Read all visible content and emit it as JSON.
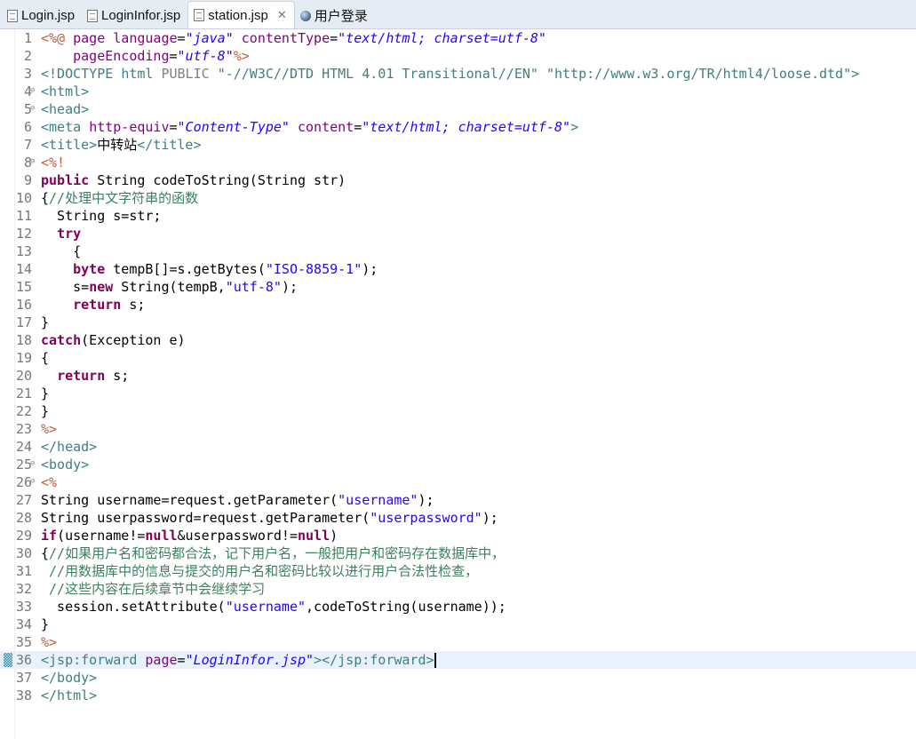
{
  "tabs": [
    {
      "label": "Login.jsp",
      "icon": "jsp-file-icon",
      "active": false
    },
    {
      "label": "LoginInfor.jsp",
      "icon": "jsp-file-icon",
      "active": false
    },
    {
      "label": "station.jsp",
      "icon": "jsp-file-icon",
      "active": true,
      "closable": true
    },
    {
      "label": "用户登录",
      "icon": "globe-icon",
      "active": false
    }
  ],
  "colors": {
    "tag": "#3f7f7f",
    "attribute": "#7f007f",
    "string": "#2a00ff",
    "jsp_delimiter": "#bf5f3f",
    "keyword": "#7f0055",
    "comment": "#3f7f5f",
    "current_line": "#e8f2fe"
  },
  "editor": {
    "current_line": 36,
    "folded_lines": [
      4,
      5,
      8,
      25,
      26
    ],
    "lines": [
      [
        [
          "jsp",
          "<%@ "
        ],
        [
          "attr",
          "page language"
        ],
        [
          "plain",
          "="
        ],
        [
          "str",
          "\"java\""
        ],
        [
          "plain",
          " "
        ],
        [
          "attr",
          "contentType"
        ],
        [
          "plain",
          "="
        ],
        [
          "str",
          "\"text/html; charset=utf-8\""
        ]
      ],
      [
        [
          "plain",
          "    "
        ],
        [
          "attr",
          "pageEncoding"
        ],
        [
          "plain",
          "="
        ],
        [
          "str",
          "\"utf-8\""
        ],
        [
          "jsp",
          "%>"
        ]
      ],
      [
        [
          "tag",
          "<!DOCTYPE "
        ],
        [
          "dtk",
          "html"
        ],
        [
          "dt",
          " PUBLIC "
        ],
        [
          "tag",
          "\"-//W3C//DTD HTML 4.01 Transitional//EN\" \"http://www.w3.org/TR/html4/loose.dtd\">"
        ]
      ],
      [
        [
          "tag",
          "<html>"
        ]
      ],
      [
        [
          "tag",
          "<head>"
        ]
      ],
      [
        [
          "tag",
          "<meta "
        ],
        [
          "attr",
          "http-equiv"
        ],
        [
          "plain",
          "="
        ],
        [
          "str",
          "\"Content-Type\""
        ],
        [
          "plain",
          " "
        ],
        [
          "attr",
          "content"
        ],
        [
          "plain",
          "="
        ],
        [
          "str",
          "\"text/html; charset=utf-8\""
        ],
        [
          "tag",
          ">"
        ]
      ],
      [
        [
          "tag",
          "<title>"
        ],
        [
          "plain",
          "中转站"
        ],
        [
          "tag",
          "</title>"
        ]
      ],
      [
        [
          "jsp",
          "<%!"
        ]
      ],
      [
        [
          "kw",
          "public"
        ],
        [
          "plain",
          " String codeToString(String str)"
        ]
      ],
      [
        [
          "plain",
          "{"
        ],
        [
          "cmt",
          "//处理中文字符串的函数"
        ]
      ],
      [
        [
          "plain",
          "  String s=str;"
        ]
      ],
      [
        [
          "plain",
          "  "
        ],
        [
          "kw",
          "try"
        ]
      ],
      [
        [
          "plain",
          "    {"
        ]
      ],
      [
        [
          "plain",
          "    "
        ],
        [
          "kw",
          "byte"
        ],
        [
          "plain",
          " tempB[]=s.getBytes("
        ],
        [
          "jstr",
          "\"ISO-8859-1\""
        ],
        [
          "plain",
          ");"
        ]
      ],
      [
        [
          "plain",
          "    s="
        ],
        [
          "kw",
          "new"
        ],
        [
          "plain",
          " String(tempB,"
        ],
        [
          "jstr",
          "\"utf-8\""
        ],
        [
          "plain",
          ");"
        ]
      ],
      [
        [
          "plain",
          "    "
        ],
        [
          "kw",
          "return"
        ],
        [
          "plain",
          " s;"
        ]
      ],
      [
        [
          "plain",
          "}"
        ]
      ],
      [
        [
          "kw",
          "catch"
        ],
        [
          "plain",
          "(Exception e)"
        ]
      ],
      [
        [
          "plain",
          "{"
        ]
      ],
      [
        [
          "plain",
          "  "
        ],
        [
          "kw",
          "return"
        ],
        [
          "plain",
          " s;"
        ]
      ],
      [
        [
          "plain",
          "}"
        ]
      ],
      [
        [
          "plain",
          "}"
        ]
      ],
      [
        [
          "jsp",
          "%>"
        ]
      ],
      [
        [
          "tag",
          "</head>"
        ]
      ],
      [
        [
          "tag",
          "<body>"
        ]
      ],
      [
        [
          "jsp",
          "<%"
        ]
      ],
      [
        [
          "plain",
          "String username=request.getParameter("
        ],
        [
          "jstr",
          "\"username\""
        ],
        [
          "plain",
          ");"
        ]
      ],
      [
        [
          "plain",
          "String userpassword=request.getParameter("
        ],
        [
          "jstr",
          "\"userpassword\""
        ],
        [
          "plain",
          ");"
        ]
      ],
      [
        [
          "kw",
          "if"
        ],
        [
          "plain",
          "(username!="
        ],
        [
          "kw",
          "null"
        ],
        [
          "plain",
          "&userpassword!="
        ],
        [
          "kw",
          "null"
        ],
        [
          "plain",
          ")"
        ]
      ],
      [
        [
          "plain",
          "{"
        ],
        [
          "cmt",
          "//如果用户名和密码都合法，记下用户名，一般把用户和密码存在数据库中，"
        ]
      ],
      [
        [
          "plain",
          " "
        ],
        [
          "cmt",
          "//用数据库中的信息与提交的用户名和密码比较以进行用户合法性检查，"
        ]
      ],
      [
        [
          "plain",
          " "
        ],
        [
          "cmt",
          "//这些内容在后续章节中会继续学习"
        ]
      ],
      [
        [
          "plain",
          "  session.setAttribute("
        ],
        [
          "jstr",
          "\"username\""
        ],
        [
          "plain",
          ",codeToString(username));"
        ]
      ],
      [
        [
          "plain",
          "}"
        ]
      ],
      [
        [
          "jsp",
          "%>"
        ]
      ],
      [
        [
          "tag",
          "<jsp:forward "
        ],
        [
          "attr",
          "page"
        ],
        [
          "plain",
          "="
        ],
        [
          "str",
          "\"LoginInfor.jsp\""
        ],
        [
          "tag",
          "></jsp:forward>"
        ]
      ],
      [
        [
          "tag",
          "</body>"
        ]
      ],
      [
        [
          "tag",
          "</html>"
        ]
      ]
    ]
  }
}
